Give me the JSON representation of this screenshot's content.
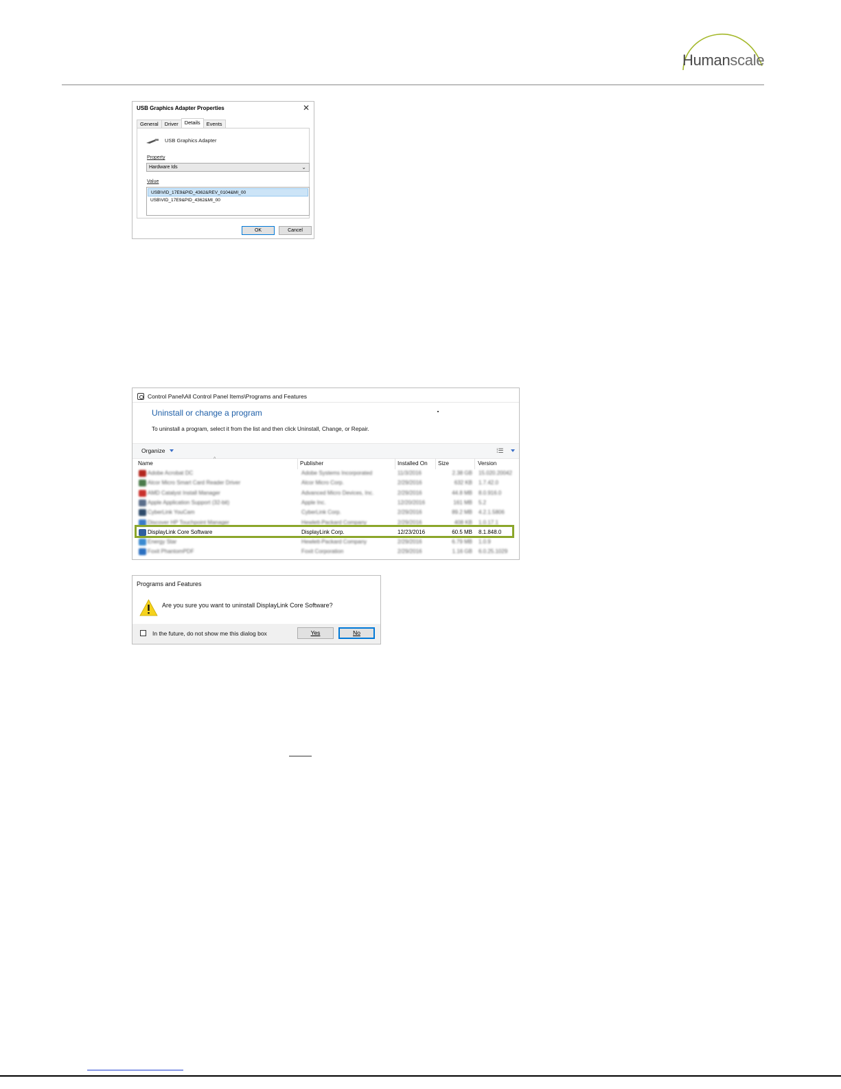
{
  "header": {
    "logo": {
      "part1": "Human",
      "part2": "scale",
      "arc_color": "#a4b82a"
    }
  },
  "properties_dialog": {
    "title": "USB Graphics Adapter Properties",
    "close_glyph": "✕",
    "tabs": [
      "General",
      "Driver",
      "Details",
      "Events"
    ],
    "active_tab": "Details",
    "device_name": "USB Graphics Adapter",
    "property_label": "Property",
    "property_value": "Hardware Ids",
    "value_label": "Value",
    "values": [
      "USB\\VID_17E9&PID_4362&REV_0104&MI_00",
      "USB\\VID_17E9&PID_4362&MI_00"
    ],
    "ok_label": "OK",
    "cancel_label": "Cancel"
  },
  "programs_window": {
    "path": "Control Panel\\All Control Panel Items\\Programs and Features",
    "heading": "Uninstall or change a program",
    "description": "To uninstall a program, select it from the list and then click Uninstall, Change, or Repair.",
    "organize_label": "Organize",
    "view_glyph": "⁞☰",
    "sort_glyph": "^",
    "columns": [
      "Name",
      "Publisher",
      "Installed On",
      "Size",
      "Version"
    ],
    "highlight_color": "#8ba62a",
    "rows": [
      {
        "name": "Adobe Acrobat DC",
        "publisher": "Adobe Systems Incorporated",
        "installed": "11/3/2016",
        "size": "2.38 GB",
        "version": "15.020.20042",
        "icon_color": "#b3261e"
      },
      {
        "name": "Alcor Micro Smart Card Reader Driver",
        "publisher": "Alcor Micro Corp.",
        "installed": "2/29/2016",
        "size": "632 KB",
        "version": "1.7.42.0",
        "icon_color": "#4a7a4a"
      },
      {
        "name": "AMD Catalyst Install Manager",
        "publisher": "Advanced Micro Devices, Inc.",
        "installed": "2/29/2016",
        "size": "44.8 MB",
        "version": "8.0.916.0",
        "icon_color": "#c9302c"
      },
      {
        "name": "Apple Application Support (32-bit)",
        "publisher": "Apple Inc.",
        "installed": "12/20/2016",
        "size": "161 MB",
        "version": "5.2",
        "icon_color": "#5a6d8a"
      },
      {
        "name": "CyberLink YouCam",
        "publisher": "CyberLink Corp.",
        "installed": "2/29/2016",
        "size": "89.2 MB",
        "version": "4.2.1.5806",
        "icon_color": "#2d4a6a"
      },
      {
        "name": "Discover HP Touchpoint Manager",
        "publisher": "Hewlett-Packard Company",
        "installed": "2/29/2016",
        "size": "408 KB",
        "version": "1.0.17.1",
        "icon_color": "#3a7bc8"
      },
      {
        "name": "DisplayLink Core Software",
        "publisher": "DisplayLink Corp.",
        "installed": "12/23/2016",
        "size": "60.5 MB",
        "version": "8.1.848.0",
        "icon_color": "#2f5fa0"
      },
      {
        "name": "Energy Star",
        "publisher": "Hewlett-Packard Company",
        "installed": "2/29/2016",
        "size": "6.79 MB",
        "version": "1.0.9",
        "icon_color": "#3a8ad0"
      },
      {
        "name": "Foxit PhantomPDF",
        "publisher": "Foxit Corporation",
        "installed": "2/29/2016",
        "size": "1.16 GB",
        "version": "6.0.25.1029",
        "icon_color": "#2a6fc0"
      }
    ]
  },
  "confirm_dialog": {
    "title": "Programs and Features",
    "message": "Are you sure you want to uninstall DisplayLink Core Software?",
    "checkbox_label": "In the future, do not show me this dialog box",
    "yes_label": "Yes",
    "no_label": "No"
  }
}
